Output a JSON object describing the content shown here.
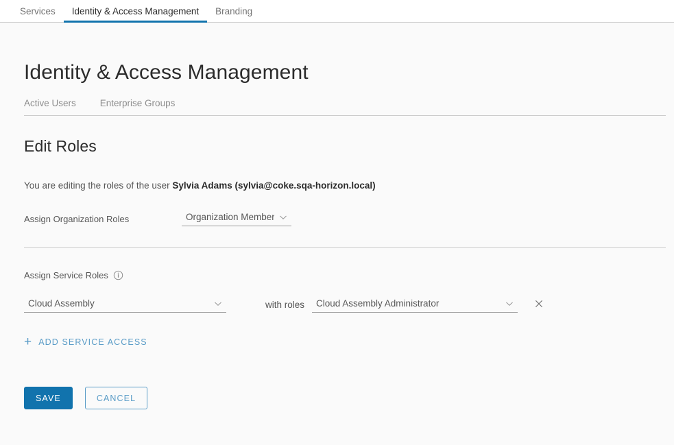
{
  "topnav": {
    "tabs": [
      {
        "label": "Services",
        "active": false
      },
      {
        "label": "Identity & Access Management",
        "active": true
      },
      {
        "label": "Branding",
        "active": false
      }
    ]
  },
  "page": {
    "title": "Identity & Access Management",
    "subtabs": [
      {
        "label": "Active Users"
      },
      {
        "label": "Enterprise Groups"
      }
    ],
    "section_title": "Edit Roles",
    "description_prefix": "You are editing the roles of the user ",
    "description_user": "Sylvia Adams (sylvia@coke.sqa-horizon.local)"
  },
  "org_roles": {
    "label": "Assign Organization Roles",
    "selected": "Organization Member",
    "chevron_icon": "chevron-down-icon"
  },
  "service_roles": {
    "label": "Assign Service Roles",
    "info_icon": "info-circle-icon",
    "with_roles_label": "with roles",
    "rows": [
      {
        "service": "Cloud Assembly",
        "role": "Cloud Assembly Administrator",
        "remove_icon": "close-icon"
      }
    ],
    "add_label": "Add Service Access",
    "add_icon": "plus-icon"
  },
  "actions": {
    "save_label": "Save",
    "cancel_label": "Cancel"
  },
  "colors": {
    "accent": "#1173ad",
    "link": "#5a9cc7",
    "text": "#565656",
    "heading": "#2b2b2b",
    "divider": "#cccccc",
    "page_bg": "#fafafa",
    "bar_bg": "#ffffff"
  }
}
